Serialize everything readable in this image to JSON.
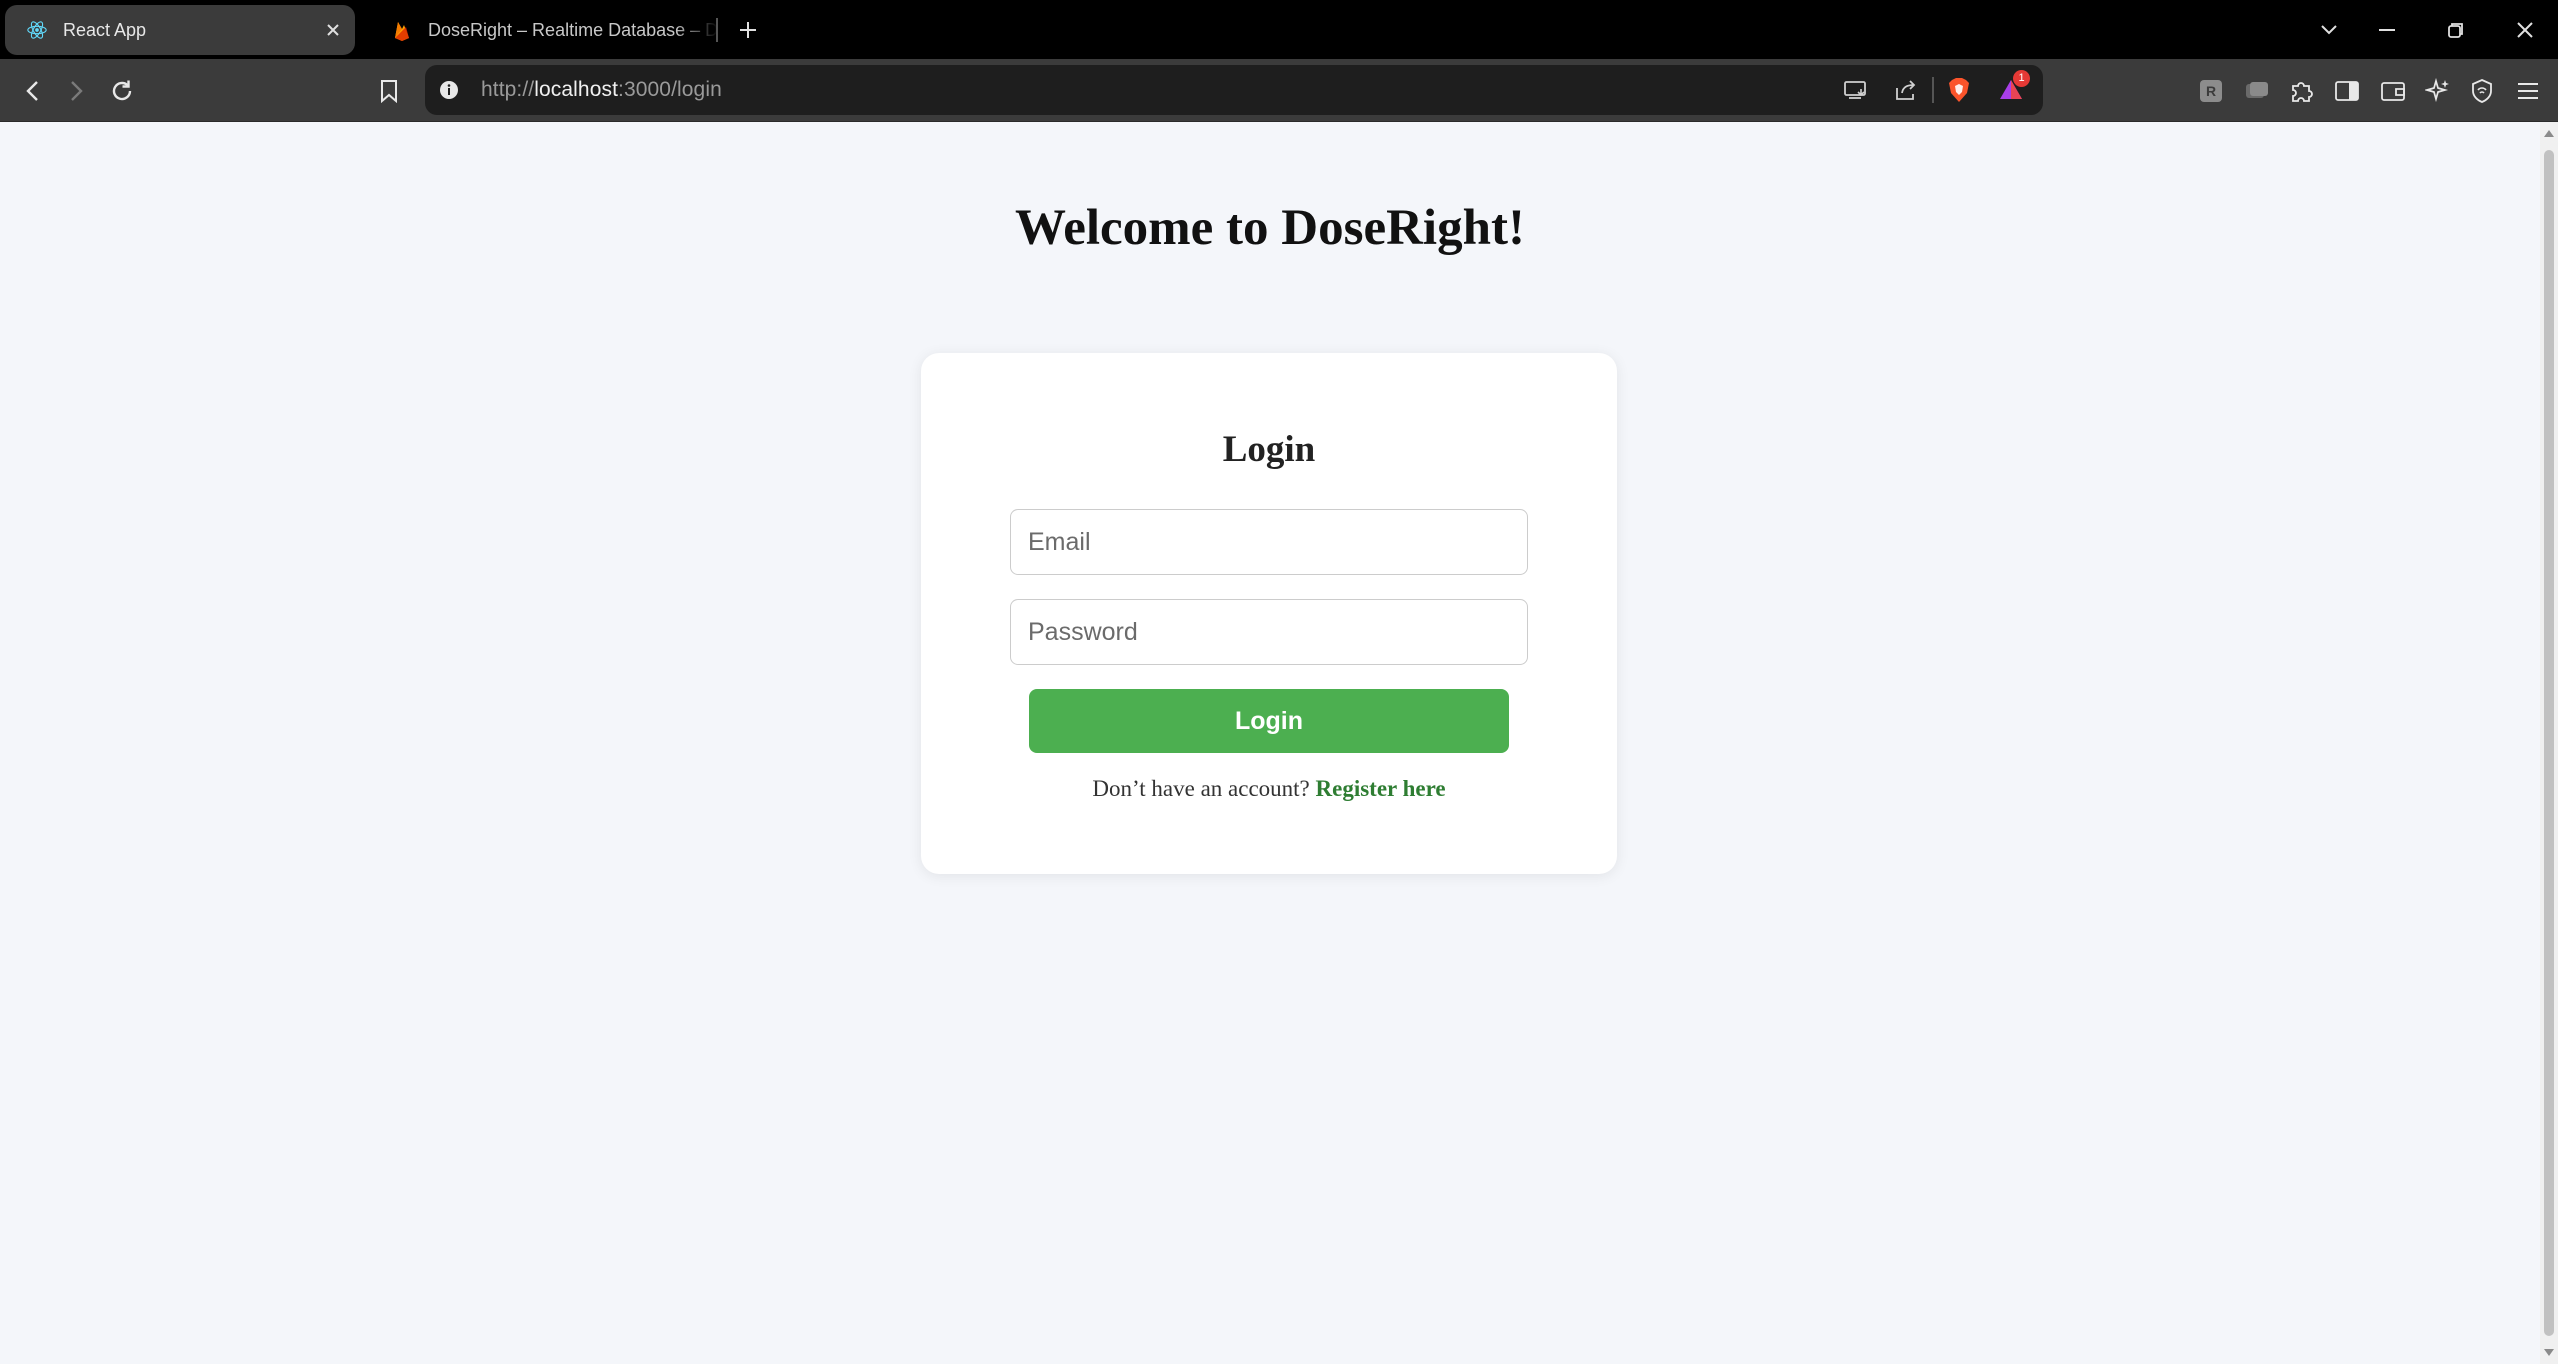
{
  "browser": {
    "tabs": [
      {
        "title": "React App",
        "active": true,
        "icon": "react-icon"
      },
      {
        "title": "DoseRight – Realtime Database – D",
        "active": false,
        "icon": "firebase-icon"
      }
    ],
    "address": {
      "scheme": "http://",
      "host": "localhost",
      "rest": ":3000/login"
    },
    "shields_badge": "1"
  },
  "page": {
    "welcome_heading": "Welcome to DoseRight!",
    "card": {
      "title": "Login",
      "email_placeholder": "Email",
      "password_placeholder": "Password",
      "submit_label": "Login",
      "register_prompt": "Don’t have an account? ",
      "register_link": "Register here"
    }
  },
  "colors": {
    "accent_green": "#4caf50",
    "link_green": "#2e7d32",
    "page_background": "#f4f6fa"
  }
}
